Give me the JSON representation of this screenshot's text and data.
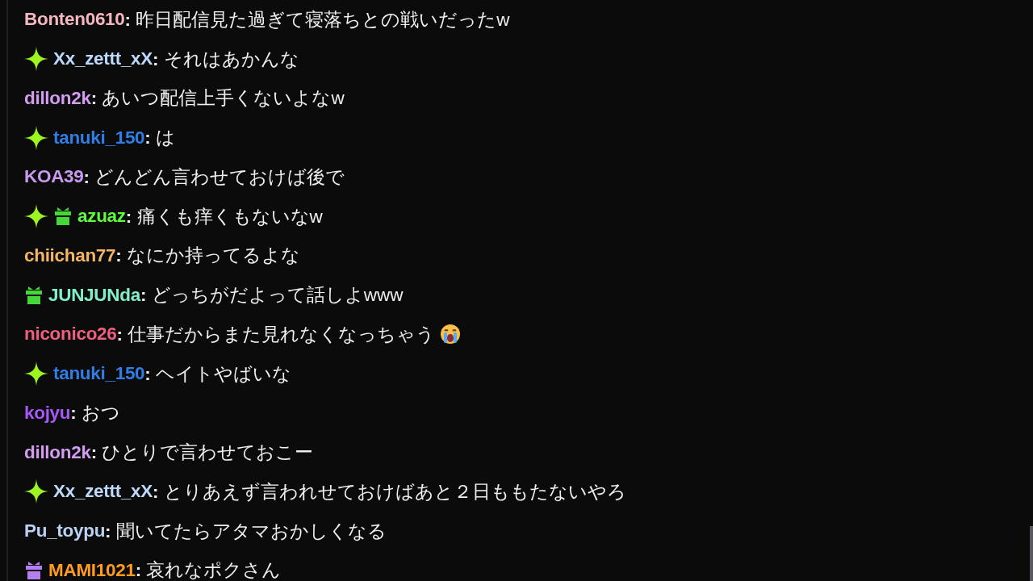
{
  "chat": {
    "messages": [
      {
        "user": "Bonten0610",
        "color": "#f5b7bf",
        "text": "**:** 昨日配信見た過ぎて寝落ちとの戦いだったw"
      },
      {
        "badges": [
          {
            "kind": "sparkle"
          }
        ],
        "user": "Xx_zettt_xX",
        "color": "#bcd9fb",
        "text": "**:** それはあかんな"
      },
      {
        "user": "dillon2k",
        "color": "#d49df2",
        "text": "**:** あいつ配信上手くないよなw"
      },
      {
        "badges": [
          {
            "kind": "sparkle"
          }
        ],
        "user": "tanuki_150",
        "color": "#2f7ee6",
        "text": "**:** は"
      },
      {
        "user": "KOA39",
        "color": "#c99bf0",
        "text": "**:** どんどん言わせておけば後で"
      },
      {
        "badges": [
          {
            "kind": "sparkle"
          },
          {
            "kind": "gift",
            "color": "#45d63a"
          }
        ],
        "user": "azuaz",
        "color": "#5efb3c",
        "text": "**:** 痛くも痒くもないなw"
      },
      {
        "user": "chiichan77",
        "color": "#f3b566",
        "text": "**:** なにか持ってるよな"
      },
      {
        "badges": [
          {
            "kind": "gift",
            "color": "#45d63a"
          }
        ],
        "user": "JUNJUNda",
        "color": "#82efcb",
        "text": "**:** どっちがだよって話しよwww"
      },
      {
        "user": "niconico26",
        "color": "#ef5f80",
        "text": "**:** 仕事だからまた見れなくなっちゃう",
        "emoji": {
          "kind": "crying"
        }
      },
      {
        "badges": [
          {
            "kind": "sparkle"
          }
        ],
        "user": "tanuki_150",
        "color": "#2f7ee6",
        "text": "**:** ヘイトやばいな"
      },
      {
        "user": "kojyu",
        "color": "#a558f5",
        "text": "**:** おつ"
      },
      {
        "user": "dillon2k",
        "color": "#d49df2",
        "text": "**:** ひとりで言わせておこー"
      },
      {
        "badges": [
          {
            "kind": "sparkle"
          }
        ],
        "user": "Xx_zettt_xX",
        "color": "#bcd9fb",
        "text": "**:** とりあえず言われせておけばあと２日ももたないやろ"
      },
      {
        "user": "Pu_toypu",
        "color": "#b9d1f2",
        "text": "**:** 聞いてたらアタマおかしくなる"
      },
      {
        "badges": [
          {
            "kind": "gift",
            "color": "#b57ff0"
          }
        ],
        "user": "MAMI1021",
        "color": "#ff9b1e",
        "text": "**:** 哀れなポクさん"
      }
    ]
  }
}
